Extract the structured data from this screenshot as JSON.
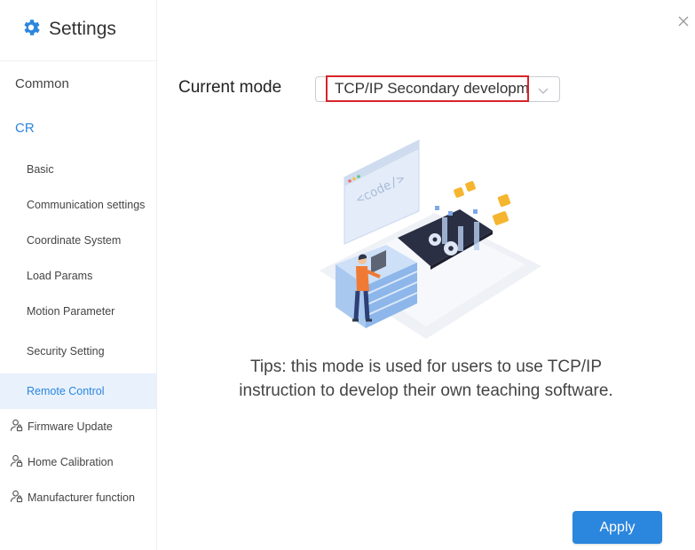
{
  "app": {
    "title": "Settings",
    "icon": "gear-icon"
  },
  "sidebar": {
    "common": "Common",
    "cr": "CR",
    "cr_items": [
      {
        "label": "Basic"
      },
      {
        "label": "Communication settings"
      },
      {
        "label": "Coordinate System"
      },
      {
        "label": "Load Params"
      },
      {
        "label": "Motion Parameter"
      },
      {
        "label": "Security Setting"
      },
      {
        "label": "Remote Control",
        "selected": true
      }
    ],
    "user_items": [
      {
        "label": "Firmware Update",
        "icon": "user-lock-icon"
      },
      {
        "label": "Home Calibration",
        "icon": "user-lock-icon"
      },
      {
        "label": "Manufacturer function",
        "icon": "user-lock-icon"
      }
    ]
  },
  "main": {
    "mode_label": "Current mode",
    "mode_value": "TCP/IP Secondary development",
    "illustration_code": "<code/>",
    "tips_line1": "Tips: this mode is used for users to use TCP/IP",
    "tips_line2": "instruction to develop their own teaching software.",
    "apply_label": "Apply"
  },
  "colors": {
    "accent": "#2b86de",
    "selected_bg": "#e8f1fc",
    "highlight_border": "#d8232a"
  }
}
